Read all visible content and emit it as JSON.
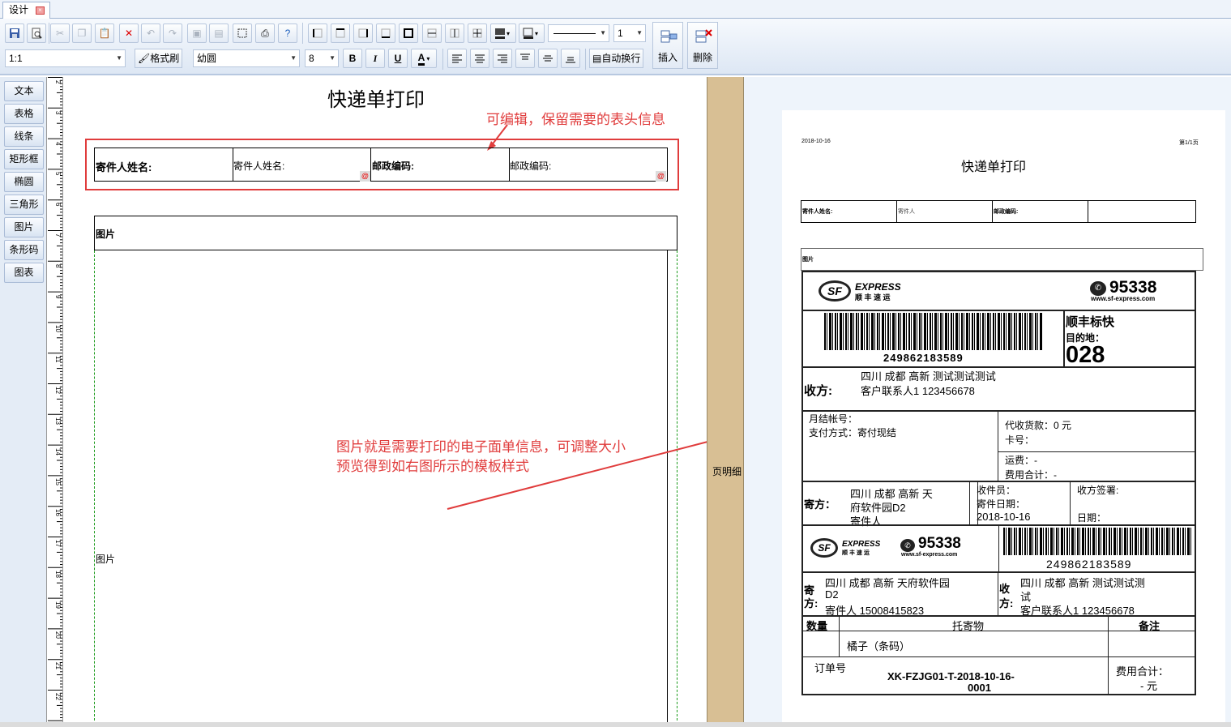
{
  "tab": {
    "label": "设计"
  },
  "toolbar": {
    "zoom": "1:1",
    "format_painter": "格式刷",
    "font_family": "幼圆",
    "font_size": "8",
    "bold": "B",
    "italic": "I",
    "underline": "U",
    "font_color": "A",
    "auto_wrap": "自动换行",
    "insert": "插入",
    "delete": "删除",
    "line_width": "1"
  },
  "left_panel": {
    "items": [
      "文本",
      "表格",
      "线条",
      "矩形框",
      "椭圆",
      "三角形",
      "图片",
      "条形码",
      "图表"
    ]
  },
  "ruler": {
    "numbers": [
      "2",
      "3",
      "4",
      "5",
      "6",
      "7",
      "8",
      "9",
      "10",
      "11",
      "12",
      "13",
      "14",
      "15",
      "16",
      "17",
      "18",
      "19",
      "20",
      "21",
      "22"
    ]
  },
  "designer": {
    "title": "快递单打印",
    "header_cells": [
      "寄件人姓名:",
      "寄件人姓名:",
      "邮政编码:",
      "邮政编码:"
    ],
    "image_header": "图片",
    "image_field": "图片",
    "annotation_top": "可编辑，保留需要的表头信息",
    "annotation_mid_line1": "图片就是需要打印的电子面单信息，可调整大小",
    "annotation_mid_line2": "预览得到如右图所示的模板样式"
  },
  "band": {
    "label": "页明细"
  },
  "preview": {
    "date": "2018-10-16",
    "page": "第1/1页",
    "title": "快递单打印",
    "header_cells": [
      "寄件人姓名:",
      "寄件人",
      "邮政编码:",
      ""
    ],
    "image_label": "图片",
    "waybill": {
      "express_en": "EXPRESS",
      "express_cn": "顺 丰 速 运",
      "sf": "SF",
      "hotline": "95338",
      "website": "www.sf-express.com",
      "tracking": "249862183589",
      "product": "顺丰标快",
      "dest_label": "目的地：",
      "dest_code": "028",
      "receiver_label": "收方:",
      "receiver_addr": "四川 成都 高新 测试测试测试",
      "receiver_contact": "客户联系人1  123456678",
      "monthly_account": "月结帐号：",
      "payment": "支付方式：寄付现结",
      "cod": "代收货款：0 元",
      "card": "卡号：",
      "freight": "运费：-",
      "total_fee": "费用合计：-",
      "sender_label": "寄方：",
      "sender_addr_1": "四川 成都 高新 天",
      "sender_addr_2": "府软件园D2",
      "sender_name": "寄件人",
      "courier": "收件员：",
      "send_date_label": "寄件日期：",
      "send_date": "2018-10-16",
      "sign": "收方签署:",
      "sign_date": "日期：",
      "tracking2": "249862183589",
      "sender2_label_1": "寄",
      "sender2_label_2": "方:",
      "sender2_addr": "四川 成都 高新 天府软件园",
      "sender2_addr2": "D2",
      "sender2_contact": "寄件人  15008415823",
      "receiver2_label_1": "收",
      "receiver2_label_2": "方:",
      "receiver2_addr": "四川 成都 高新 测试测试测",
      "receiver2_addr2": "试",
      "receiver2_contact": "客户联系人1  123456678",
      "qty": "数量",
      "goods": "托寄物",
      "remark": "备注",
      "goods_value": "橘子（条码）",
      "order_label": "订单号",
      "order_no_1": "XK-FZJG01-T-2018-10-16-",
      "order_no_2": "0001",
      "fee_label": "费用合计：",
      "fee_value": "- 元"
    }
  },
  "colors": {
    "annotation": "#e03c3c",
    "band": "#d8bf94",
    "toolbar_bg": "#dde7f4"
  }
}
